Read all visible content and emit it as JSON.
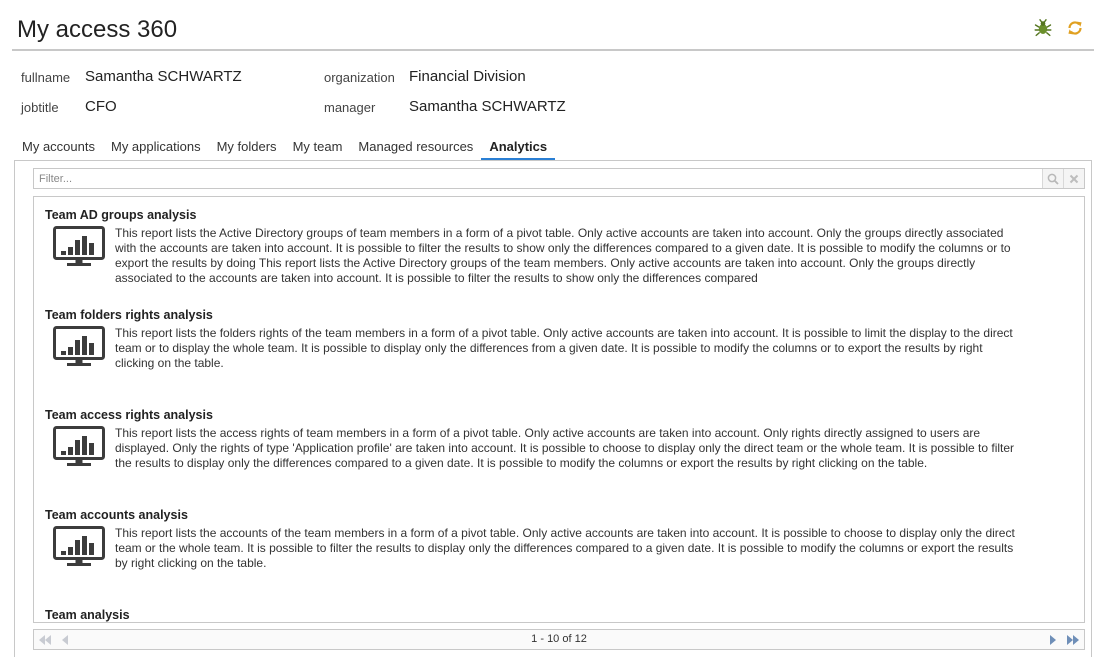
{
  "app": {
    "title": "My access 360",
    "icons": [
      "bug-icon",
      "refresh-icon"
    ],
    "accent_color": "#2a7fd4"
  },
  "identity": {
    "fullname_label": "fullname",
    "fullname": "Samantha SCHWARTZ",
    "organization_label": "organization",
    "organization": "Financial Division",
    "jobtitle_label": "jobtitle",
    "jobtitle": "CFO",
    "manager_label": "manager",
    "manager": "Samantha SCHWARTZ"
  },
  "tabs": [
    {
      "label": "My accounts"
    },
    {
      "label": "My applications"
    },
    {
      "label": "My folders"
    },
    {
      "label": "My team"
    },
    {
      "label": "Managed resources"
    },
    {
      "label": "Analytics",
      "active": true
    }
  ],
  "filter": {
    "placeholder": "Filter...",
    "icons": [
      "search-icon",
      "clear-icon"
    ]
  },
  "reports": [
    {
      "title": "Team AD groups analysis",
      "icon": "chart-monitor-icon",
      "description": "This report lists the Active Directory groups of team members in a form of a pivot table. Only active accounts are taken into account. Only the groups directly associated with the accounts are taken into account. It is possible to filter the results to show only the differences compared to a given date. It is possible to modify the columns or to export the results by doing This report lists the Active Directory groups of the team members. Only active accounts are taken into account. Only the groups directly associated to the accounts are taken into account. It is possible to filter the results to show only the differences compared"
    },
    {
      "title": "Team folders rights analysis",
      "icon": "chart-monitor-icon",
      "description": "This report lists the folders rights of the team members in a form of a pivot table. Only active accounts are taken into account. It is possible to limit the display to the direct team or to display the whole team. It is possible to display only the differences from a given date. It is possible to modify the columns or to export the results by right clicking on the table."
    },
    {
      "title": "Team access rights analysis",
      "icon": "chart-monitor-icon",
      "description": "This report lists the access rights of team members in a form of a pivot table. Only active accounts are taken into account. Only rights directly assigned to users are displayed. Only the rights of type 'Application profile' are taken into account. It is possible to choose to display only the direct team or the whole team. It is possible to filter the results to display only the differences compared to a given date. It is possible to modify the columns or export the results by right clicking on the table."
    },
    {
      "title": "Team accounts analysis",
      "icon": "chart-monitor-icon",
      "description": "This report lists the accounts of the team members in a form of a pivot table. Only active accounts are taken into account. It is possible to choose to display only the direct team or the whole team. It is possible to filter the results to display only the differences compared to a given date. It is possible to modify the columns or export the results by right clicking on the table."
    },
    {
      "title": "Team analysis"
    }
  ],
  "pager": {
    "text": "1 - 10 of 12",
    "icons": [
      "first-page-icon",
      "prev-page-icon",
      "next-page-icon",
      "last-page-icon"
    ]
  }
}
